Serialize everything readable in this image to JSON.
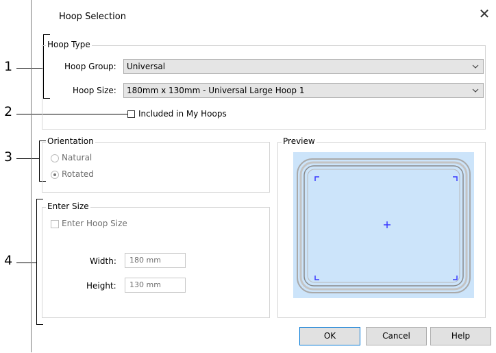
{
  "dialog": {
    "title": "Hoop Selection",
    "close_label": "✕"
  },
  "callouts": [
    "1",
    "2",
    "3",
    "4"
  ],
  "hoop_type": {
    "group_label": "Hoop Type",
    "hoop_group_label": "Hoop Group:",
    "hoop_group_value": "Universal",
    "hoop_size_label": "Hoop Size:",
    "hoop_size_value": "180mm x 130mm - Universal Large Hoop 1",
    "included_label": "Included in My Hoops",
    "included_checked": false
  },
  "orientation": {
    "group_label": "Orientation",
    "options": [
      "Natural",
      "Rotated"
    ],
    "selected": "Rotated"
  },
  "preview": {
    "group_label": "Preview",
    "plus": "+"
  },
  "enter_size": {
    "group_label": "Enter Size",
    "checkbox_label": "Enter Hoop Size",
    "checked": false,
    "width_label": "Width:",
    "width_value": "180 mm",
    "height_label": "Height:",
    "height_value": "130 mm"
  },
  "buttons": {
    "ok": "OK",
    "cancel": "Cancel",
    "help": "Help"
  },
  "icons": {
    "close": "close-icon",
    "dropdown": "chevron-down-icon"
  },
  "colors": {
    "preview_bg": "#cce4fa",
    "hoop_frame": "#a9a9a9",
    "corner_marks": "#3a3aff",
    "combo_bg": "#e5e5e5"
  }
}
